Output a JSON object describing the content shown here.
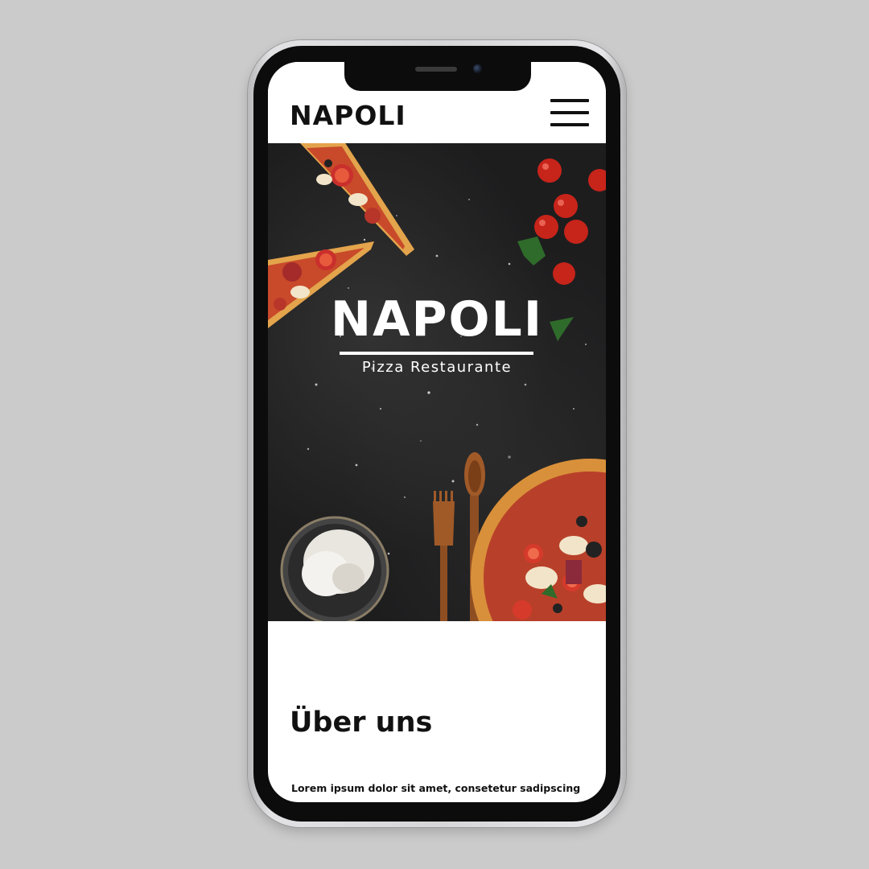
{
  "header": {
    "brand": "NAPOLI",
    "menu_icon": "hamburger-menu-icon"
  },
  "hero": {
    "title": "NAPOLI",
    "subtitle": "Pizza Restaurante"
  },
  "about": {
    "heading": "Über uns",
    "text": "Lorem ipsum dolor sit amet, consetetur sadipscing"
  },
  "colors": {
    "backdrop": "#cbcbcb",
    "hero_background": "#1d1d1e",
    "text_dark": "#111111",
    "text_light": "#ffffff"
  }
}
